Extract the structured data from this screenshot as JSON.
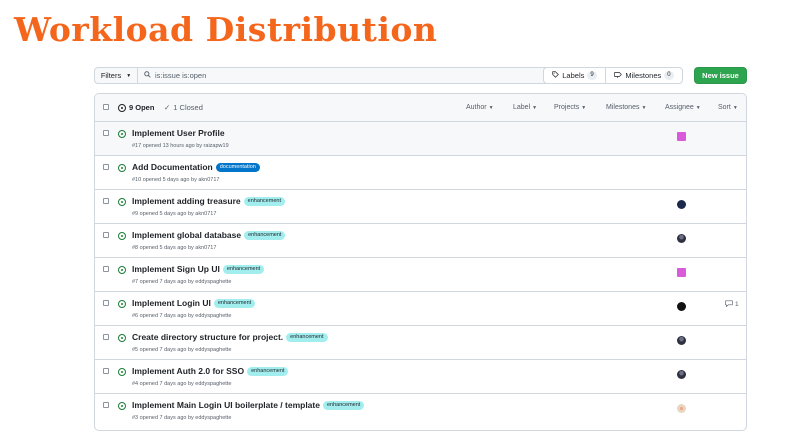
{
  "slide_title": "Workload Distribution",
  "toolbar": {
    "filters_label": "Filters",
    "search_value": "is:issue is:open",
    "labels_label": "Labels",
    "labels_count": "9",
    "milestones_label": "Milestones",
    "milestones_count": "0",
    "new_issue_label": "New issue",
    "new_issue_color": "#2da44e"
  },
  "header": {
    "open_label": "9 Open",
    "closed_label": "1 Closed",
    "filters": [
      "Author",
      "Label",
      "Projects",
      "Milestones",
      "Assignee",
      "Sort"
    ]
  },
  "issues": [
    {
      "title": "Implement User Profile",
      "label": "",
      "meta": "#17 opened 13 hours ago by raizapw19",
      "avatar": "pink-pixel-avatar",
      "comments": ""
    },
    {
      "title": "Add Documentation",
      "label": "documentation",
      "meta": "#10 opened 5 days ago by akn0717",
      "avatar": "",
      "comments": ""
    },
    {
      "title": "Implement adding treasure",
      "label": "enhancement",
      "meta": "#9 opened 5 days ago by akn0717",
      "avatar": "navy-avatar",
      "comments": ""
    },
    {
      "title": "Implement global database",
      "label": "enhancement",
      "meta": "#8 opened 5 days ago by akn0717",
      "avatar": "person-avatar",
      "comments": ""
    },
    {
      "title": "Implement Sign Up UI",
      "label": "enhancement",
      "meta": "#7 opened 7 days ago by eddyspaghette",
      "avatar": "pink-pixel-avatar",
      "comments": ""
    },
    {
      "title": "Implement Login UI",
      "label": "enhancement",
      "meta": "#6 opened 7 days ago by eddyspaghette",
      "avatar": "black-avatar",
      "comments": "1"
    },
    {
      "title": "Create directory structure for project.",
      "label": "enhancement",
      "meta": "#5 opened 7 days ago by eddyspaghette",
      "avatar": "person-avatar",
      "comments": ""
    },
    {
      "title": "Implement Auth 2.0 for SSO",
      "label": "enhancement",
      "meta": "#4 opened 7 days ago by eddyspaghette",
      "avatar": "person-avatar",
      "comments": ""
    },
    {
      "title": "Implement Main Login UI boilerplate / template",
      "label": "enhancement",
      "meta": "#3 opened 7 days ago by eddyspaghette",
      "avatar": "beige-avatar",
      "comments": ""
    }
  ],
  "colors": {
    "title_orange": "#f4661c",
    "documentation_label": "#0075ca",
    "enhancement_label": "#a2eeef",
    "open_icon": "#1a7f37"
  }
}
